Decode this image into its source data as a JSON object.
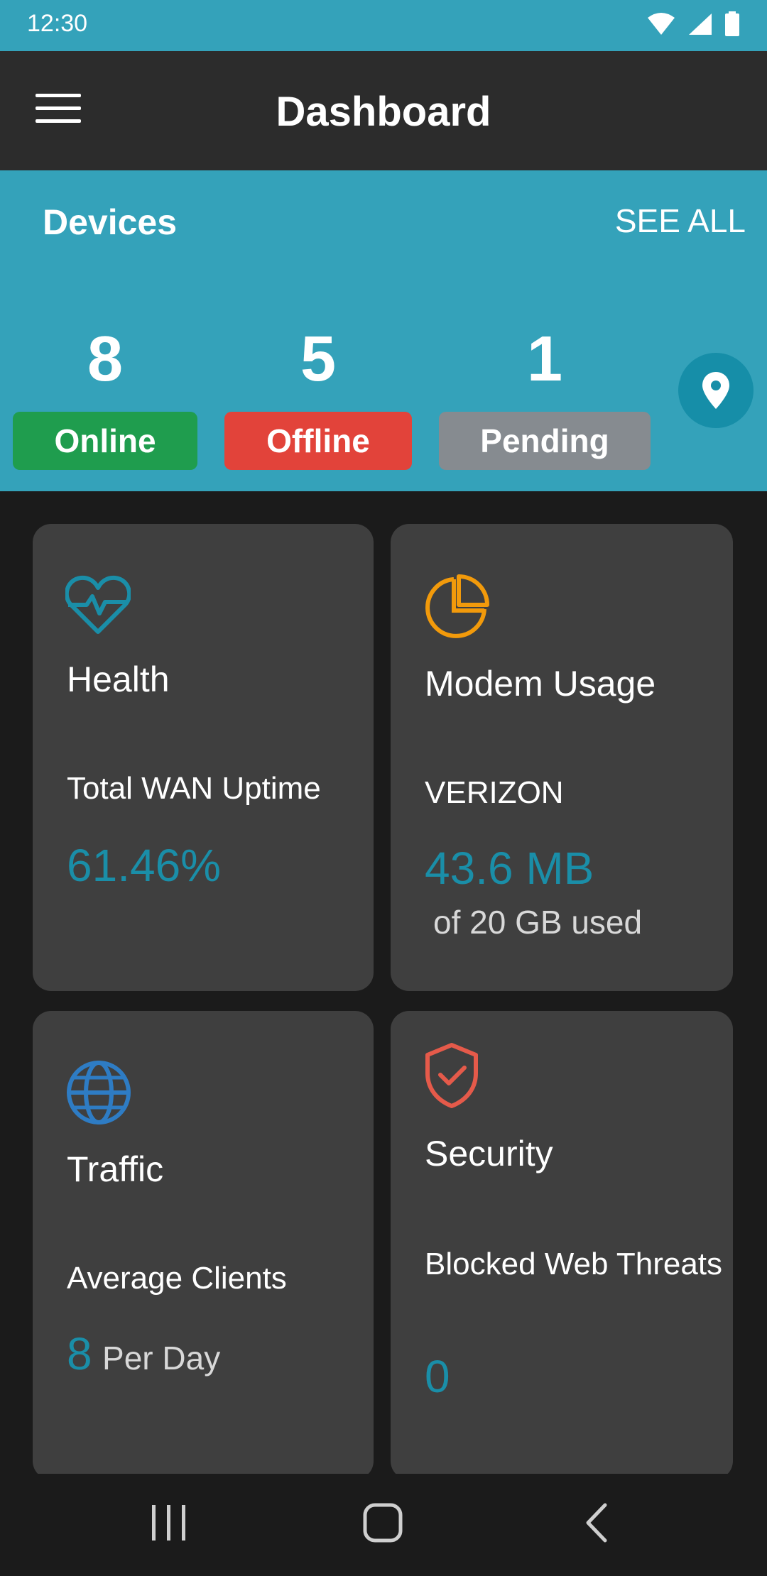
{
  "status_bar": {
    "time": "12:30"
  },
  "app_bar": {
    "title": "Dashboard"
  },
  "devices": {
    "title": "Devices",
    "see_all": "SEE ALL",
    "online": {
      "count": "8",
      "label": "Online",
      "color": "#1f9d4e"
    },
    "offline": {
      "count": "5",
      "label": "Offline",
      "color": "#e2433a"
    },
    "pending": {
      "count": "1",
      "label": "Pending",
      "color": "#868b90"
    }
  },
  "cards": {
    "health": {
      "title": "Health",
      "label": "Total WAN Uptime",
      "value": "61.46%",
      "icon": "heart-pulse-icon"
    },
    "modem": {
      "title": "Modem Usage",
      "label": "VERIZON",
      "value": "43.6 MB",
      "sub": "of 20 GB used",
      "icon": "pie-chart-icon"
    },
    "traffic": {
      "title": "Traffic",
      "label": "Average Clients",
      "value": "8",
      "sub": "Per Day",
      "icon": "globe-icon"
    },
    "security": {
      "title": "Security",
      "label": "Blocked Web Threats",
      "value": "0",
      "icon": "shield-check-icon"
    }
  },
  "colors": {
    "accent": "#34a2ba",
    "value": "#1a8ea8",
    "card": "#3f3f3f"
  }
}
